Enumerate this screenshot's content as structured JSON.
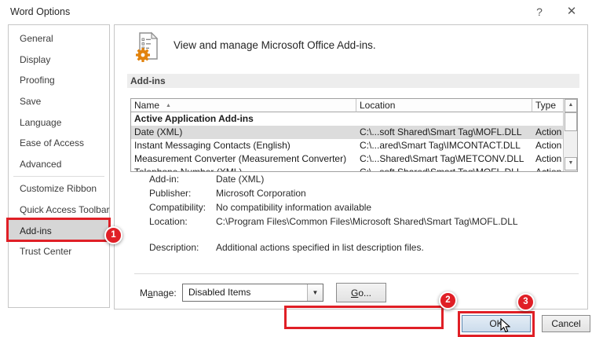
{
  "window": {
    "title": "Word Options",
    "help_icon": "?",
    "close_icon": "✕"
  },
  "sidebar": {
    "items": [
      "General",
      "Display",
      "Proofing",
      "Save",
      "Language",
      "Ease of Access",
      "Advanced",
      "Customize Ribbon",
      "Quick Access Toolbar",
      "Add-ins",
      "Trust Center"
    ],
    "selected": "Add-ins",
    "divider_after": "Advanced"
  },
  "main": {
    "header": "View and manage Microsoft Office Add-ins.",
    "section_title": "Add-ins",
    "table": {
      "columns": [
        "Name",
        "Location",
        "Type"
      ],
      "group_header": "Active Application Add-ins",
      "rows": [
        {
          "name": "Date (XML)",
          "location": "C:\\...soft Shared\\Smart Tag\\MOFL.DLL",
          "type": "Action",
          "selected": true
        },
        {
          "name": "Instant Messaging Contacts (English)",
          "location": "C:\\...ared\\Smart Tag\\IMCONTACT.DLL",
          "type": "Action",
          "selected": false
        },
        {
          "name": "Measurement Converter (Measurement Converter)",
          "location": "C:\\...Shared\\Smart Tag\\METCONV.DLL",
          "type": "Action",
          "selected": false
        },
        {
          "name": "Telephone Number (XML)",
          "location": "C:\\...soft Shared\\Smart Tag\\MOFL.DLL",
          "type": "Action",
          "selected": false
        }
      ]
    },
    "details": {
      "rows": [
        {
          "label": "Add-in:",
          "value": "Date (XML)"
        },
        {
          "label": "Publisher:",
          "value": "Microsoft Corporation"
        },
        {
          "label": "Compatibility:",
          "value": "No compatibility information available"
        },
        {
          "label": "Location:",
          "value": "C:\\Program Files\\Common Files\\Microsoft Shared\\Smart Tag\\MOFL.DLL"
        },
        {
          "label": "Description:",
          "value": "Additional actions specified in list description files."
        }
      ]
    },
    "manage": {
      "label_pre": "M",
      "label_accel": "a",
      "label_post": "nage:",
      "value": "Disabled Items",
      "go_accel": "G",
      "go_rest": "o..."
    }
  },
  "footer": {
    "ok_label": "OK",
    "cancel_label": "Cancel"
  },
  "annotations": {
    "step1": "1",
    "step2": "2",
    "step3": "3",
    "color": "#e01f26"
  }
}
